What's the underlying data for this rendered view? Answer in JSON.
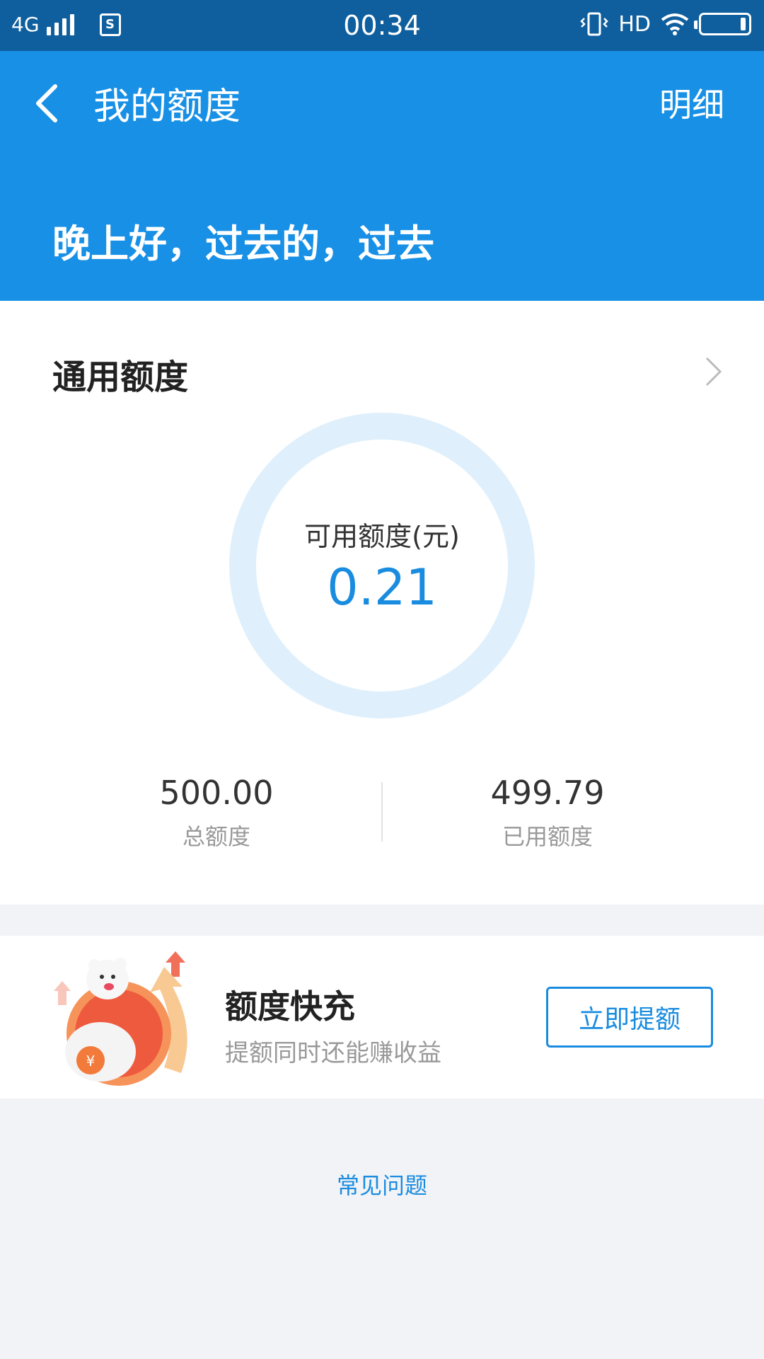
{
  "status_bar": {
    "network": "4G",
    "sim_label": "S",
    "time": "00:34",
    "hd_label": "HD"
  },
  "header": {
    "title": "我的额度",
    "detail_link": "明细",
    "greeting": "晚上好，过去的，过去",
    "background_color": "#1890e6"
  },
  "credit_card": {
    "title": "通用额度",
    "available_label": "可用额度(元)",
    "available_value": "0.21",
    "available_fraction": 0.0004,
    "total_value": "500.00",
    "total_label": "总额度",
    "used_value": "499.79",
    "used_label": "已用额度"
  },
  "promo": {
    "title": "额度快充",
    "subtitle": "提额同时还能赚收益",
    "button_label": "立即提额",
    "mascot_icon": "mascot-money-bag-icon"
  },
  "faq_link": "常见问题",
  "accent_color": "#1a8ce0"
}
